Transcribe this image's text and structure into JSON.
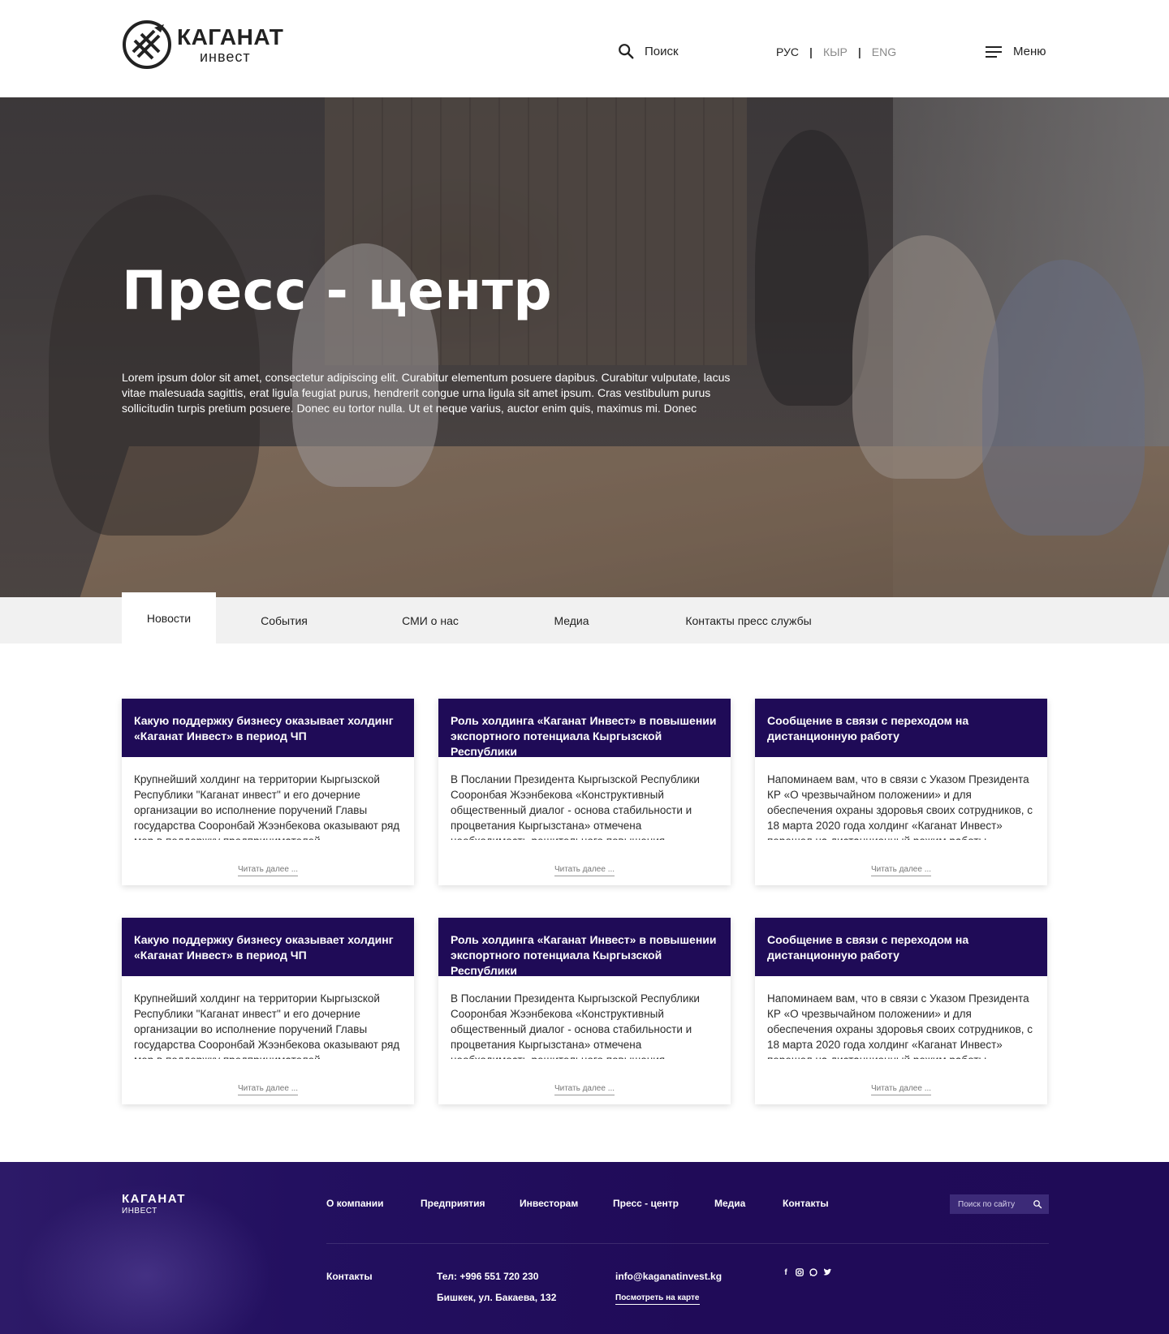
{
  "header": {
    "logo": {
      "line1": "КАГАНАТ",
      "line2": "ИНВЕСТ"
    },
    "search_label": "Поиск",
    "languages": [
      "РУС",
      "КЫР",
      "ENG"
    ],
    "active_language": "РУС",
    "menu_label": "Меню"
  },
  "hero": {
    "title": "Пресс - центр",
    "text": "Lorem ipsum dolor sit amet, consectetur adipiscing elit. Curabitur elementum posuere dapibus. Curabitur vulputate, lacus vitae malesuada sagittis, erat ligula feugiat purus, hendrerit congue urna ligula sit amet ipsum. Cras vestibulum purus sollicitudin turpis pretium posuere. Donec eu tortor nulla. Ut et neque varius, auctor enim quis, maximus mi. Donec"
  },
  "tabs": [
    "Новости",
    "События",
    "СМИ о нас",
    "Медиа",
    "Контакты пресс службы"
  ],
  "active_tab": "Новости",
  "cards": [
    {
      "title": "Какую поддержку бизнесу оказывает холдинг «Каганат Инвест» в период ЧП",
      "text": "Крупнейший холдинг на территории Кыргызской Республики \"Каганат инвест\" и его дочерние организации во исполнение поручений Главы государства Сооронбай Жээнбекова оказывают ряд мер в поддержку предпринимателей,",
      "link": "Читать далее ..."
    },
    {
      "title": "Роль холдинга «Каганат Инвест» в повышении экспортного потенциала Кыргызской Республики",
      "text": "В Послании Президента Кыргызской Республики Сооронбая Жээнбекова «Конструктивный общественный диалог - основа стабильности и процветания Кыргызстана» отмечена необходимость решительного повышения",
      "link": "Читать далее ..."
    },
    {
      "title": "Сообщение в связи с переходом на дистанционную работу",
      "text": "Напоминаем вам, что в связи с Указом Президента КР «О чрезвычайном положении» и для обеспечения охраны здоровья своих сотрудников, с 18 марта 2020 года холдинг «Каганат Инвест» перешел на дистанционный режим работы.",
      "link": "Читать далее ..."
    },
    {
      "title": "Какую поддержку бизнесу оказывает холдинг «Каганат Инвест» в период ЧП",
      "text": "Крупнейший холдинг на территории Кыргызской Республики \"Каганат инвест\" и его дочерние организации во исполнение поручений Главы государства Сооронбай Жээнбекова оказывают ряд мер в поддержку предпринимателей,",
      "link": "Читать далее ..."
    },
    {
      "title": "Роль холдинга «Каганат Инвест» в повышении экспортного потенциала Кыргызской Республики",
      "text": "В Послании Президента Кыргызской Республики Сооронбая Жээнбекова «Конструктивный общественный диалог - основа стабильности и процветания Кыргызстана» отмечена необходимость решительного повышения",
      "link": "Читать далее ..."
    },
    {
      "title": "Сообщение в связи с переходом на дистанционную работу",
      "text": "Напоминаем вам, что в связи с Указом Президента КР «О чрезвычайном положении» и для обеспечения охраны здоровья своих сотрудников, с 18 марта 2020 года холдинг «Каганат Инвест» перешел на дистанционный режим работы.",
      "link": "Читать далее ..."
    }
  ],
  "footer": {
    "logo": {
      "line1": "КАГАНАТ",
      "line2": "ИНВЕСТ"
    },
    "nav": [
      "О компании",
      "Предприятия",
      "Инвесторам",
      "Пресс - центр",
      "Медиа",
      "Контакты"
    ],
    "search_placeholder": "Поиск по сайту",
    "contacts_label": "Контакты",
    "phone": "Тел: +996 551 720 230",
    "address": "Бишкек, ул. Бакаева, 132",
    "email": "info@kaganatinvest.kg",
    "map_link": "Посмотреть на карте",
    "socials": [
      "facebook-icon",
      "instagram-icon",
      "whatsapp-icon",
      "twitter-icon"
    ]
  },
  "colors": {
    "brand_dark": "#1f0b57",
    "tab_bar": "#f1f1f1"
  }
}
